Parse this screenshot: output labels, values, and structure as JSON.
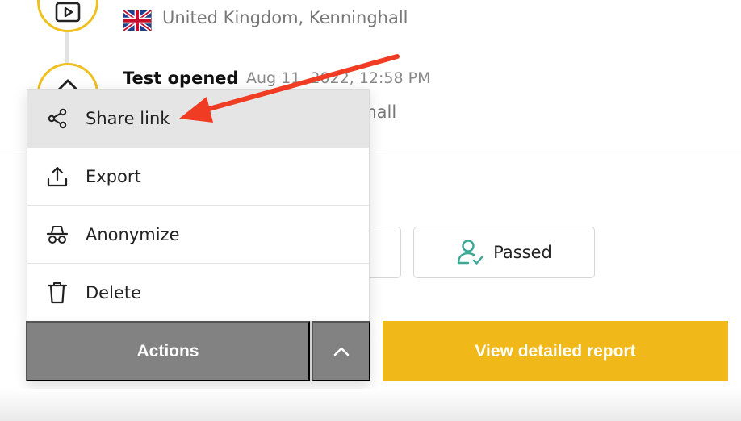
{
  "timeline": {
    "previous_event": {
      "location": "United Kingdom, Kenninghall",
      "icon": "play-video-icon"
    },
    "current_event": {
      "title": "Test opened",
      "time": "Aug 11, 2022, 12:58 PM",
      "location_partial": "ghall",
      "icon": "chevron-up-icon"
    }
  },
  "menu": {
    "items": [
      {
        "label": "Share link",
        "icon": "share-icon"
      },
      {
        "label": "Export",
        "icon": "export-upload-icon"
      },
      {
        "label": "Anonymize",
        "icon": "incognito-icon"
      },
      {
        "label": "Delete",
        "icon": "trash-icon"
      }
    ]
  },
  "actions": {
    "label": "Actions",
    "toggle_icon": "chevron-up-icon"
  },
  "status": {
    "passed_label": "Passed",
    "passed_icon": "user-check-icon"
  },
  "report_button": {
    "label": "View detailed report"
  },
  "colors": {
    "accent_yellow": "#f0b919",
    "timeline_circle": "#f0c020",
    "actions_gray": "#828282",
    "passed_teal": "#3aa895",
    "annotation_red": "#f03c22"
  }
}
